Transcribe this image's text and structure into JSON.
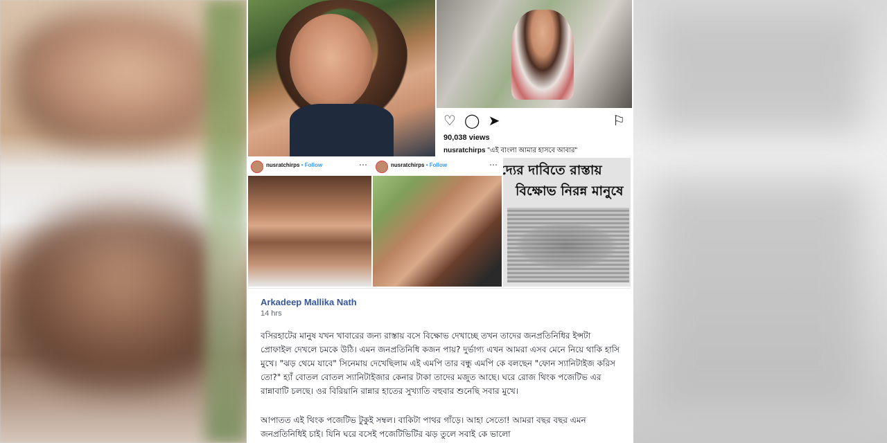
{
  "instagram_post": {
    "views": "90,038 views",
    "username": "nusratchirps",
    "caption": "\"এই বাংলা আমার হাসবে আবার\""
  },
  "cards": [
    {
      "username": "nusratchirps",
      "follow": "• Follow"
    },
    {
      "username": "nusratchirps",
      "follow": "• Follow"
    }
  ],
  "newspaper": {
    "line1": "দ্যের দাবিতে রাস্তায়",
    "line2": "বিক্ষোভ নিরন্ন মানুষে"
  },
  "post": {
    "author": "Arkadeep Mallika Nath",
    "time": "14 hrs",
    "paragraph1": "বসিরহাটের মানুষ যখন খাবারের জন্য রাস্তায় বসে বিক্ষোভ দেখাচ্ছে তখন তাদের জনপ্রতিনিধির ইন্সটা প্রোফাইল দেখলে চমকে উঠি। এমন জনপ্রতিনিধি কজন পায়? দুর্ভাগ্য এখন আমরা এসব মেনে নিয়ে থাকি হাসি মুখে। \"ঝড় থেমে যাবে\" সিনেমায় দেখেছিলাম এই এমপি তার বন্ধু এমপি কে বলছেন \"ফোন স্যানিটাইজ করিস তো?\" হ্যাঁ বোতল বোতল স্যানিটাইজার কেনার টাকা তাদের মজুত আছে। ঘরে রোজ থিংক পজেটিভ এর রান্নাবাটি চলছে। ওর বিরিয়ানি রান্নার হাতের সুখ্যাতি বহুবার শুনেছি সবার মুখে।",
    "paragraph2": "আপাতত এই থিংক পজেটিভ টুকুই সম্বল। বাকিটা পাথর গাঁড়ে। আহা সেতো! আমরা বছর বছর এমন জনপ্রতিনিধিই চাই। যিনি ঘরে বসেই পজেটিভিটির ঝড় তুলে সবাই কে ভালো"
  }
}
